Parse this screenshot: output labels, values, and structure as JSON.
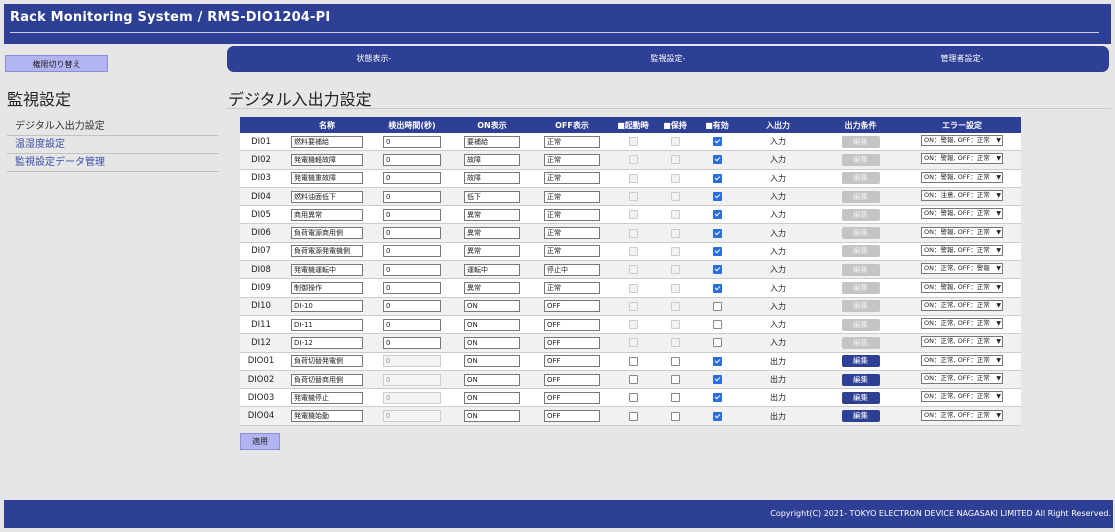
{
  "header": {
    "title": "Rack Monitoring System / RMS-DIO1204-PI"
  },
  "nav": {
    "items": [
      "状態表示-",
      "監視設定-",
      "管理者設定-"
    ]
  },
  "switch_button": "権限切り替え",
  "sidebar": {
    "title": "監視設定",
    "items": [
      "デジタル入出力設定",
      "温湿度設定",
      "監視設定データ管理"
    ]
  },
  "page_title": "デジタル入出力設定",
  "table": {
    "headers": {
      "name": "名称",
      "detect": "検出時間(秒)",
      "on": "ON表示",
      "off": "OFF表示",
      "startup": "■起動時",
      "hold": "■保持",
      "enabled": "■有効",
      "io": "入出力",
      "output_cond": "出力条件",
      "error": "エラー設定"
    },
    "edit_label": "編集",
    "rows": [
      {
        "id": "DI01",
        "name": "燃料要補給",
        "sec": "0",
        "on": "要補給",
        "off": "正常",
        "startup": false,
        "hold": false,
        "enabled": true,
        "io": "入力",
        "output": false,
        "error": "ON：警報, OFF：正常"
      },
      {
        "id": "DI02",
        "name": "発電機軽故障",
        "sec": "0",
        "on": "故障",
        "off": "正常",
        "startup": false,
        "hold": false,
        "enabled": true,
        "io": "入力",
        "output": false,
        "error": "ON：警報, OFF：正常"
      },
      {
        "id": "DI03",
        "name": "発電機重故障",
        "sec": "0",
        "on": "故障",
        "off": "正常",
        "startup": false,
        "hold": false,
        "enabled": true,
        "io": "入力",
        "output": false,
        "error": "ON：警報, OFF：正常"
      },
      {
        "id": "DI04",
        "name": "燃料油面低下",
        "sec": "0",
        "on": "低下",
        "off": "正常",
        "startup": false,
        "hold": false,
        "enabled": true,
        "io": "入力",
        "output": false,
        "error": "ON：注意, OFF：正常"
      },
      {
        "id": "DI05",
        "name": "商用異常",
        "sec": "0",
        "on": "異常",
        "off": "正常",
        "startup": false,
        "hold": false,
        "enabled": true,
        "io": "入力",
        "output": false,
        "error": "ON：警報, OFF：正常"
      },
      {
        "id": "DI06",
        "name": "負荷電源商用側",
        "sec": "0",
        "on": "異常",
        "off": "正常",
        "startup": false,
        "hold": false,
        "enabled": true,
        "io": "入力",
        "output": false,
        "error": "ON：警報, OFF：正常"
      },
      {
        "id": "DI07",
        "name": "負荷電源発電機側",
        "sec": "0",
        "on": "異常",
        "off": "正常",
        "startup": false,
        "hold": false,
        "enabled": true,
        "io": "入力",
        "output": false,
        "error": "ON：警報, OFF：正常"
      },
      {
        "id": "DI08",
        "name": "発電機運転中",
        "sec": "0",
        "on": "運転中",
        "off": "停止中",
        "startup": false,
        "hold": false,
        "enabled": true,
        "io": "入力",
        "output": false,
        "error": "ON：正常, OFF：警報"
      },
      {
        "id": "DI09",
        "name": "制御操作",
        "sec": "0",
        "on": "異常",
        "off": "正常",
        "startup": false,
        "hold": false,
        "enabled": true,
        "io": "入力",
        "output": false,
        "error": "ON：警報, OFF：正常"
      },
      {
        "id": "DI10",
        "name": "DI-10",
        "sec": "0",
        "on": "ON",
        "off": "OFF",
        "startup": false,
        "hold": false,
        "enabled": false,
        "io": "入力",
        "output": false,
        "error": "ON：正常, OFF：正常"
      },
      {
        "id": "DI11",
        "name": "DI-11",
        "sec": "0",
        "on": "ON",
        "off": "OFF",
        "startup": false,
        "hold": false,
        "enabled": false,
        "io": "入力",
        "output": false,
        "error": "ON：正常, OFF：正常"
      },
      {
        "id": "DI12",
        "name": "DI-12",
        "sec": "0",
        "on": "ON",
        "off": "OFF",
        "startup": false,
        "hold": false,
        "enabled": false,
        "io": "入力",
        "output": false,
        "error": "ON：正常, OFF：正常"
      },
      {
        "id": "DIO01",
        "name": "負荷切替発電側",
        "sec": "0",
        "on": "ON",
        "off": "OFF",
        "startup": false,
        "hold": false,
        "enabled": true,
        "io": "出力",
        "output": true,
        "error": "ON：正常, OFF：正常"
      },
      {
        "id": "DIO02",
        "name": "負荷切替商用側",
        "sec": "0",
        "on": "ON",
        "off": "OFF",
        "startup": false,
        "hold": false,
        "enabled": true,
        "io": "出力",
        "output": true,
        "error": "ON：正常, OFF：正常"
      },
      {
        "id": "DIO03",
        "name": "発電機停止",
        "sec": "0",
        "on": "ON",
        "off": "OFF",
        "startup": false,
        "hold": false,
        "enabled": true,
        "io": "出力",
        "output": true,
        "error": "ON：正常, OFF：正常"
      },
      {
        "id": "DIO04",
        "name": "発電機始動",
        "sec": "0",
        "on": "ON",
        "off": "OFF",
        "startup": false,
        "hold": false,
        "enabled": true,
        "io": "出力",
        "output": true,
        "error": "ON：正常, OFF：正常"
      }
    ]
  },
  "apply_button": "適用",
  "footer": {
    "copyright": "Copyright(C) 2021- TOKYO ELECTRON DEVICE NAGASAKI LIMITED All Right Reserved."
  },
  "colors": {
    "primary": "#2e3f96",
    "button": "#b2b4f2",
    "background": "#e6e6e6"
  }
}
